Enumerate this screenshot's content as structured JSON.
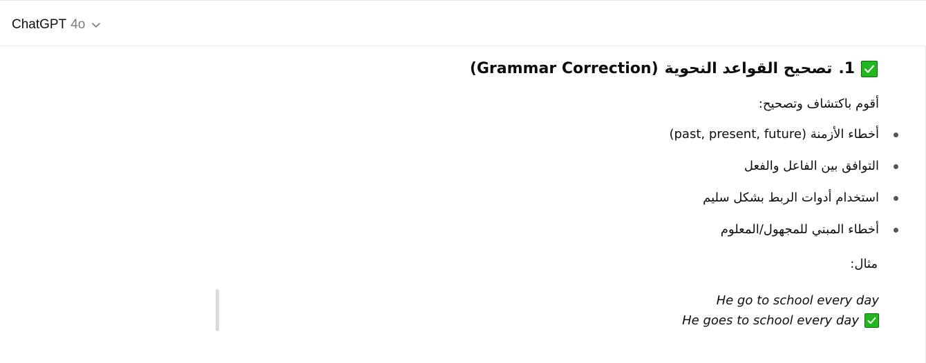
{
  "header": {
    "model_name": "ChatGPT",
    "model_version": "4o"
  },
  "message": {
    "heading_number": "1.",
    "heading_text": "تصحيح القواعد النحوية",
    "heading_english": "(Grammar Correction)",
    "intro": "أقوم باكتشاف وتصحيح:",
    "bullets": [
      {
        "arabic": "أخطاء الأزمنة",
        "english": "(past, present, future)"
      },
      {
        "arabic": "التوافق بين الفاعل والفعل",
        "english": ""
      },
      {
        "arabic": "استخدام أدوات الربط بشكل سليم",
        "english": ""
      },
      {
        "arabic": "أخطاء المبني للمجهول/المعلوم",
        "english": ""
      }
    ],
    "example_label": "مثال:",
    "example_wrong": "He go to school every day",
    "example_correct": "He goes to school every day"
  },
  "colors": {
    "check_green": "#1fb81f"
  },
  "icons": {
    "check": "check-mark-icon",
    "chevron": "chevron-down-icon"
  }
}
